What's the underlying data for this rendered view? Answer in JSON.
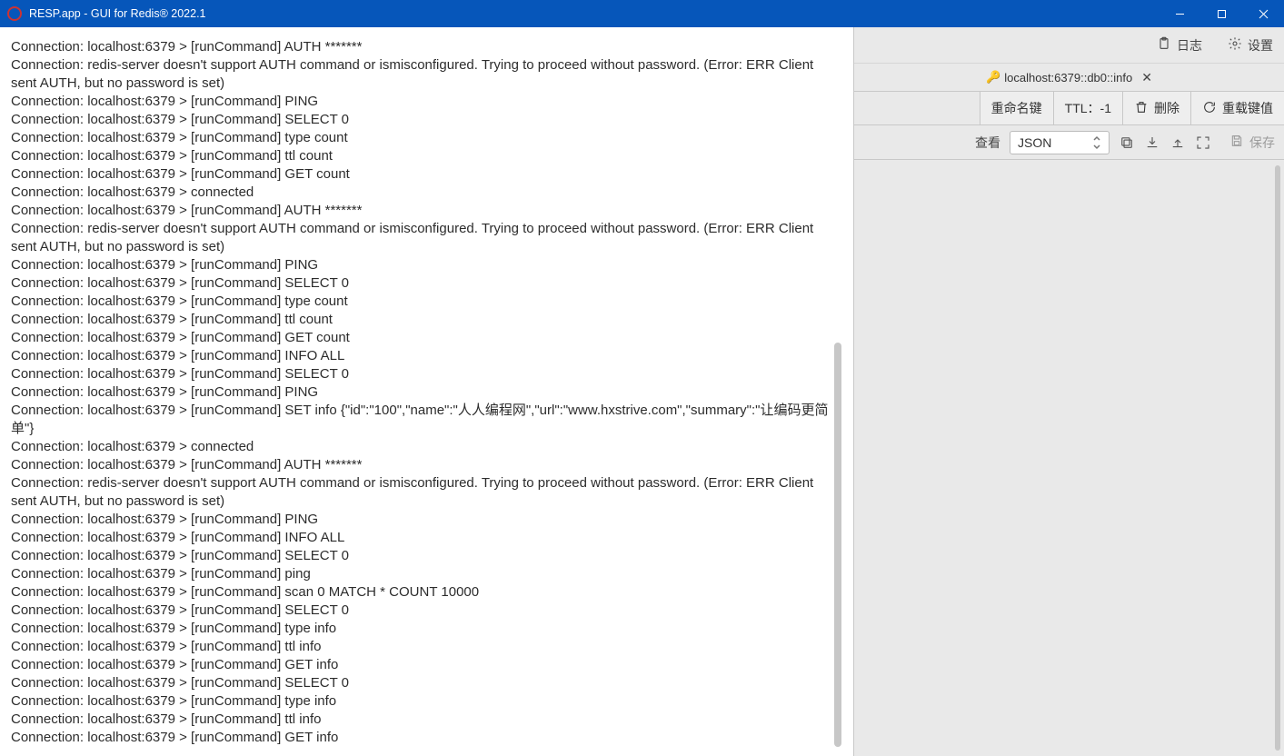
{
  "window": {
    "title": "RESP.app - GUI for Redis® 2022.1"
  },
  "header": {
    "log_label": "日志",
    "settings_label": "设置"
  },
  "tab": {
    "key_icon": "🔑",
    "label": "localhost:6379::db0::info"
  },
  "actions": {
    "rename_label": "重命名键",
    "ttl_label": "TTL：-1",
    "delete_label": "删除",
    "reload_label": "重载键值"
  },
  "view": {
    "view_label": "查看",
    "format_value": "JSON",
    "save_label": "保存"
  },
  "log_lines": [
    "Connection: localhost:6379 > [runCommand] AUTH *******",
    "Connection: redis-server doesn't support AUTH command or ismisconfigured. Trying to proceed without password. (Error: ERR Client sent AUTH, but no password is set)",
    "Connection: localhost:6379 > [runCommand] PING",
    "Connection: localhost:6379 > [runCommand] SELECT 0",
    "Connection: localhost:6379 > [runCommand] type count",
    "Connection: localhost:6379 > [runCommand] ttl count",
    "Connection: localhost:6379 > [runCommand] GET count",
    "Connection: localhost:6379 > connected",
    "Connection: localhost:6379 > [runCommand] AUTH *******",
    "Connection: redis-server doesn't support AUTH command or ismisconfigured. Trying to proceed without password. (Error: ERR Client sent AUTH, but no password is set)",
    "Connection: localhost:6379 > [runCommand] PING",
    "Connection: localhost:6379 > [runCommand] SELECT 0",
    "Connection: localhost:6379 > [runCommand] type count",
    "Connection: localhost:6379 > [runCommand] ttl count",
    "Connection: localhost:6379 > [runCommand] GET count",
    "Connection: localhost:6379 > [runCommand] INFO ALL",
    "Connection: localhost:6379 > [runCommand] SELECT 0",
    "Connection: localhost:6379 > [runCommand] PING",
    "Connection: localhost:6379 > [runCommand] SET info {\"id\":\"100\",\"name\":\"人人编程网\",\"url\":\"www.hxstrive.com\",\"summary\":\"让编码更简单\"}",
    "Connection: localhost:6379 > connected",
    "Connection: localhost:6379 > [runCommand] AUTH *******",
    "Connection: redis-server doesn't support AUTH command or ismisconfigured. Trying to proceed without password. (Error: ERR Client sent AUTH, but no password is set)",
    "Connection: localhost:6379 > [runCommand] PING",
    "Connection: localhost:6379 > [runCommand] INFO ALL",
    "Connection: localhost:6379 > [runCommand] SELECT 0",
    "Connection: localhost:6379 > [runCommand] ping",
    "Connection: localhost:6379 > [runCommand] scan 0 MATCH * COUNT 10000",
    "Connection: localhost:6379 > [runCommand] SELECT 0",
    "Connection: localhost:6379 > [runCommand] type info",
    "Connection: localhost:6379 > [runCommand] ttl info",
    "Connection: localhost:6379 > [runCommand] GET info",
    "Connection: localhost:6379 > [runCommand] SELECT 0",
    "Connection: localhost:6379 > [runCommand] type info",
    "Connection: localhost:6379 > [runCommand] ttl info",
    "Connection: localhost:6379 > [runCommand] GET info"
  ]
}
